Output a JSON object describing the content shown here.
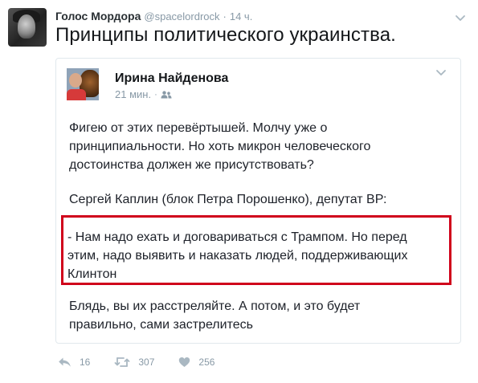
{
  "tweet": {
    "author_name": "Голос Мордора",
    "author_handle": "@spacelordrock",
    "separator": "·",
    "time": "14 ч.",
    "text": "Принципы политического украинства."
  },
  "quote": {
    "author_name": "Ирина Найденова",
    "time": "21 мин.",
    "separator": "·",
    "paragraph1": [
      "Фигею от этих перевёртышей. Молчу уже о",
      "принципиальности. Но хоть микрон человеческого",
      "достоинства должен же присутствовать?"
    ],
    "paragraph2": [
      "Сергей Каплин (блок Петра Порошенко), депутат ВР:"
    ],
    "highlighted": [
      "- Нам надо ехать и договариваться с Трампом. Но перед",
      "этим, надо выявить и наказать людей, поддерживающих",
      "Клинтон"
    ],
    "paragraph3": [
      "Блядь, вы их расстреляйте. А потом, и это будет",
      "правильно, сами застрелитесь"
    ]
  },
  "actions": {
    "reply_count": "16",
    "retweet_count": "307",
    "like_count": "256"
  },
  "colors": {
    "highlight_border": "#d0021b",
    "muted": "#8899a6",
    "card_border": "#e1e8ed"
  },
  "icons": [
    "chevron-down-icon",
    "friends-icon",
    "reply-icon",
    "retweet-icon",
    "like-icon"
  ]
}
